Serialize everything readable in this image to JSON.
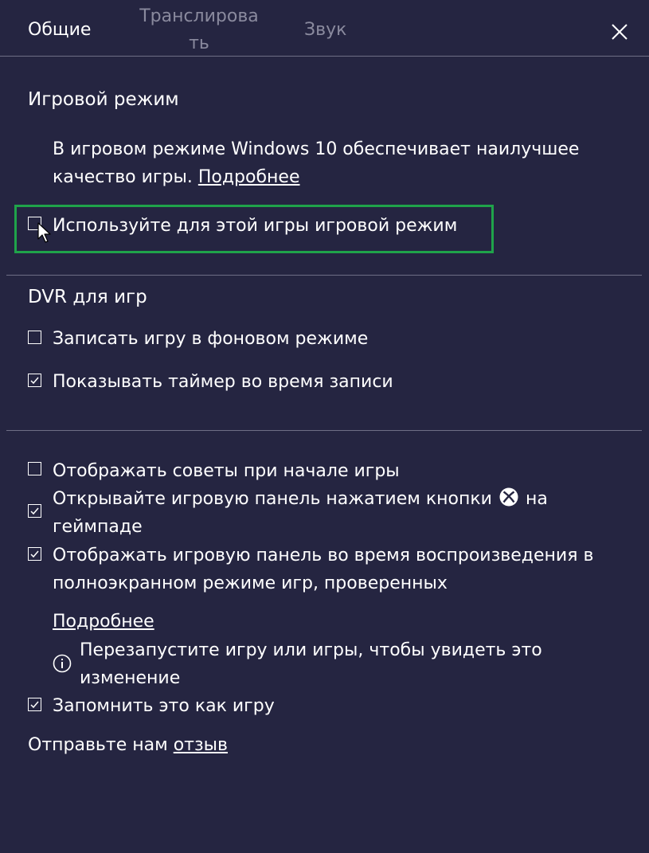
{
  "tabs": {
    "general": "Общие",
    "stream": "Транслирова ть",
    "sound": "Звук"
  },
  "game_mode": {
    "heading": "Игровой режим",
    "description": "В игровом режиме Windows 10 обеспечивает наилучшее качество игры.",
    "learn_more": "Подробнее",
    "checkbox_label": "Используйте для этой игры игровой режим",
    "checkbox_checked": false
  },
  "dvr": {
    "heading": "DVR для игр",
    "record_background": "Записать игру в фоновом режиме",
    "record_background_checked": false,
    "show_timer": "Показывать таймер во время записи",
    "show_timer_checked": true
  },
  "misc": {
    "show_tips": "Отображать советы при начале игры",
    "show_tips_checked": false,
    "open_with_gamepad_pre": "Открывайте игровую панель нажатием кнопки",
    "open_with_gamepad_post": "на геймпаде",
    "open_with_gamepad_checked": true,
    "show_fullscreen": "Отображать игровую панель во время воспроизведения в полноэкранном режиме игр, проверенных",
    "show_fullscreen_checked": true,
    "learn_more": "Подробнее",
    "restart_notice": "Перезапустите игру или игры, чтобы увидеть это изменение",
    "remember_game": "Запомнить это как игру",
    "remember_game_checked": true
  },
  "feedback": {
    "prefix": "Отправьте нам",
    "link": "отзыв"
  },
  "icons": {
    "close": "close-icon",
    "xbox": "xbox-logo-icon",
    "info": "info-icon",
    "cursor": "mouse-cursor-icon",
    "checkmark": "checkmark-icon"
  },
  "colors": {
    "background": "#252541",
    "highlight_border": "#1fa34a",
    "inactive_tab": "#8a8a9e",
    "divider": "#6e6e85"
  }
}
